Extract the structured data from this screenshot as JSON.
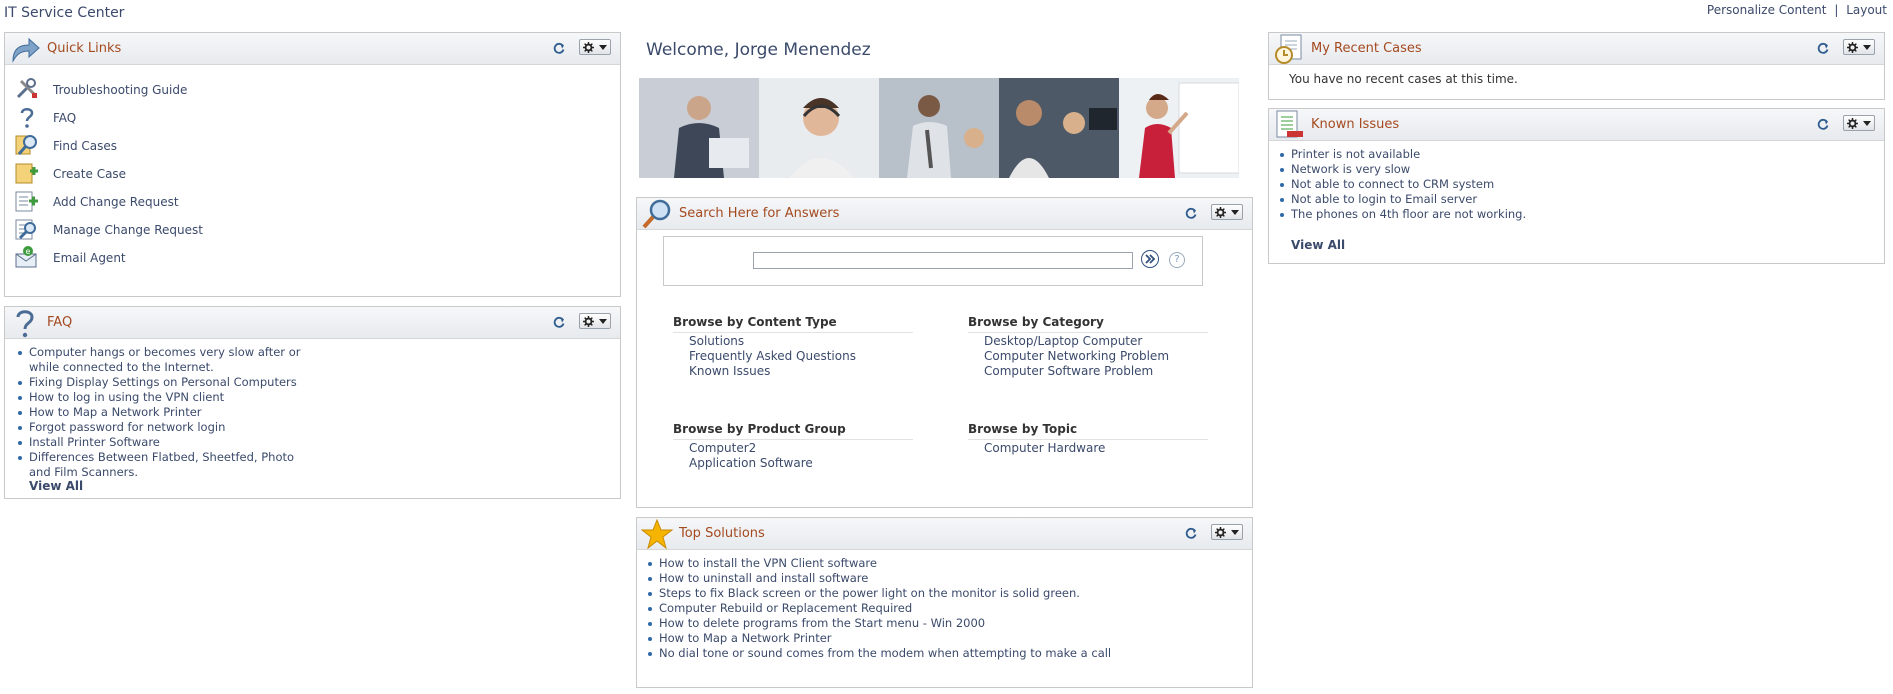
{
  "app": {
    "title": "IT Service Center"
  },
  "top_links": {
    "personalize": "Personalize Content",
    "separator": "|",
    "layout": "Layout"
  },
  "quick_links": {
    "title": "Quick Links",
    "items": [
      {
        "label": "Troubleshooting Guide",
        "icon": "tools-icon"
      },
      {
        "label": "FAQ",
        "icon": "question-icon"
      },
      {
        "label": "Find Cases",
        "icon": "magnifier-icon"
      },
      {
        "label": "Create Case",
        "icon": "create-case-icon"
      },
      {
        "label": "Add Change Request",
        "icon": "add-change-icon"
      },
      {
        "label": "Manage Change Request",
        "icon": "manage-change-icon"
      },
      {
        "label": "Email Agent",
        "icon": "email-agent-icon"
      }
    ]
  },
  "faq": {
    "title": "FAQ",
    "items": [
      "Computer hangs or becomes very slow after or while connected to the Internet.",
      "Fixing Display Settings on Personal Computers",
      "How to log in using the VPN client",
      "How to Map a Network Printer",
      "Forgot password for network login",
      "Install Printer Software",
      "Differences Between Flatbed, Sheetfed, Photo and Film Scanners."
    ],
    "view_all": "View All"
  },
  "welcome": {
    "text": "Welcome, Jorge Menendez"
  },
  "search": {
    "title": "Search Here for Answers",
    "input_value": "",
    "help_glyph": "?",
    "browse": [
      {
        "heading": "Browse by Content Type",
        "links": [
          "Solutions",
          "Frequently Asked Questions",
          "Known Issues"
        ]
      },
      {
        "heading": "Browse by Category",
        "links": [
          "Desktop/Laptop Computer",
          "Computer Networking Problem",
          "Computer Software Problem"
        ]
      },
      {
        "heading": "Browse by Product Group",
        "links": [
          "Computer2",
          "Application Software"
        ]
      },
      {
        "heading": "Browse by Topic",
        "links": [
          "Computer Hardware"
        ]
      }
    ]
  },
  "top_solutions": {
    "title": "Top Solutions",
    "items": [
      "How to install the VPN Client software",
      "How to uninstall and install software",
      "Steps to fix Black screen or the power light on the monitor is solid green.",
      "Computer Rebuild or Replacement Required",
      "How to delete programs from the Start menu - Win 2000",
      "How to Map a Network Printer",
      "No dial tone or sound comes from the modem when attempting to make a call"
    ]
  },
  "recent_cases": {
    "title": "My Recent Cases",
    "message": "You have no recent cases at this time."
  },
  "known_issues": {
    "title": "Known Issues",
    "items": [
      "Printer is not available",
      "Network is very slow",
      "Not able to connect to CRM system",
      "Not able to login to Email server",
      "The phones on 4th floor are not working."
    ],
    "view_all": "View All"
  },
  "colors": {
    "title_orange": "#a44a1f",
    "link_blue": "#3b4a6b",
    "bullet_blue": "#2f6aa7",
    "header_gray": "#e7eaee"
  }
}
